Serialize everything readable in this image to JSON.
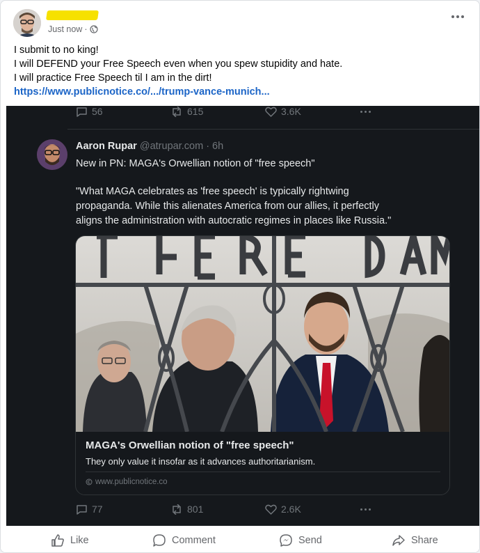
{
  "post": {
    "timestamp": "Just now",
    "privacy_icon": "globe-icon",
    "lines": [
      "I submit to no king!",
      "I will DEFEND your Free Speech even when you spew stupidity and hate.",
      "I will practice Free Speech til I am in the dirt!"
    ],
    "link": "https://www.publicnotice.co/.../trump-vance-munich..."
  },
  "tweet_top": {
    "replies": "56",
    "reposts": "615",
    "likes": "3.6K"
  },
  "quoted": {
    "name": "Aaron Rupar",
    "handle": "@atrupar.com",
    "time": "· 6h",
    "text1": "New in PN: MAGA's Orwellian notion of \"free speech\"",
    "text2_lines": [
      "\"What MAGA celebrates as 'free speech' is typically rightwing",
      "propaganda. While this alienates America from our allies, it perfectly",
      "aligns the administration with autocratic regimes in places like Russia.\""
    ],
    "card": {
      "title": "MAGA's Orwellian notion of \"free speech\"",
      "description": "They only value it insofar as it advances authoritarianism.",
      "domain": "www.publicnotice.co"
    },
    "replies": "77",
    "reposts": "801",
    "likes": "2.6K"
  },
  "actions": {
    "like": "Like",
    "comment": "Comment",
    "send": "Send",
    "share": "Share"
  },
  "colors": {
    "link": "#1c65c7",
    "dark_bg": "#15181c",
    "muted": "#65676b",
    "highlight": "#f6e100"
  }
}
